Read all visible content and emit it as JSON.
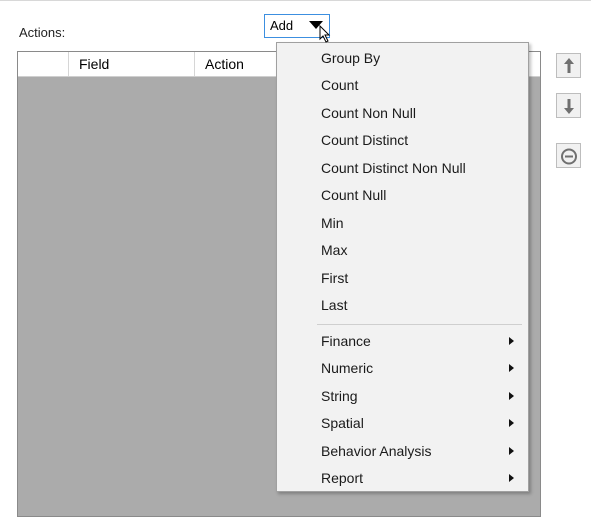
{
  "form": {
    "actions_label": "Actions:",
    "add_button_label": "Add"
  },
  "grid": {
    "columns": [
      "",
      "Field",
      "Action"
    ]
  },
  "side_buttons": {
    "move_up_icon": "arrow-up-icon",
    "move_down_icon": "arrow-down-icon",
    "remove_icon": "minus-circle-icon"
  },
  "menu": {
    "items": [
      {
        "label": "Group By",
        "submenu": false
      },
      {
        "label": "Count",
        "submenu": false
      },
      {
        "label": "Count Non Null",
        "submenu": false
      },
      {
        "label": "Count Distinct",
        "submenu": false
      },
      {
        "label": "Count Distinct Non Null",
        "submenu": false
      },
      {
        "label": "Count Null",
        "submenu": false
      },
      {
        "label": "Min",
        "submenu": false
      },
      {
        "label": "Max",
        "submenu": false
      },
      {
        "label": "First",
        "submenu": false
      },
      {
        "label": "Last",
        "submenu": false
      },
      {
        "label": "Finance",
        "submenu": true
      },
      {
        "label": "Numeric",
        "submenu": true
      },
      {
        "label": "String",
        "submenu": true
      },
      {
        "label": "Spatial",
        "submenu": true
      },
      {
        "label": "Behavior Analysis",
        "submenu": true
      },
      {
        "label": "Report",
        "submenu": true
      }
    ]
  },
  "colors": {
    "grid_background": "#ababab",
    "button_focus_border": "#3c8fe0",
    "menu_background": "#f2f2f2"
  }
}
